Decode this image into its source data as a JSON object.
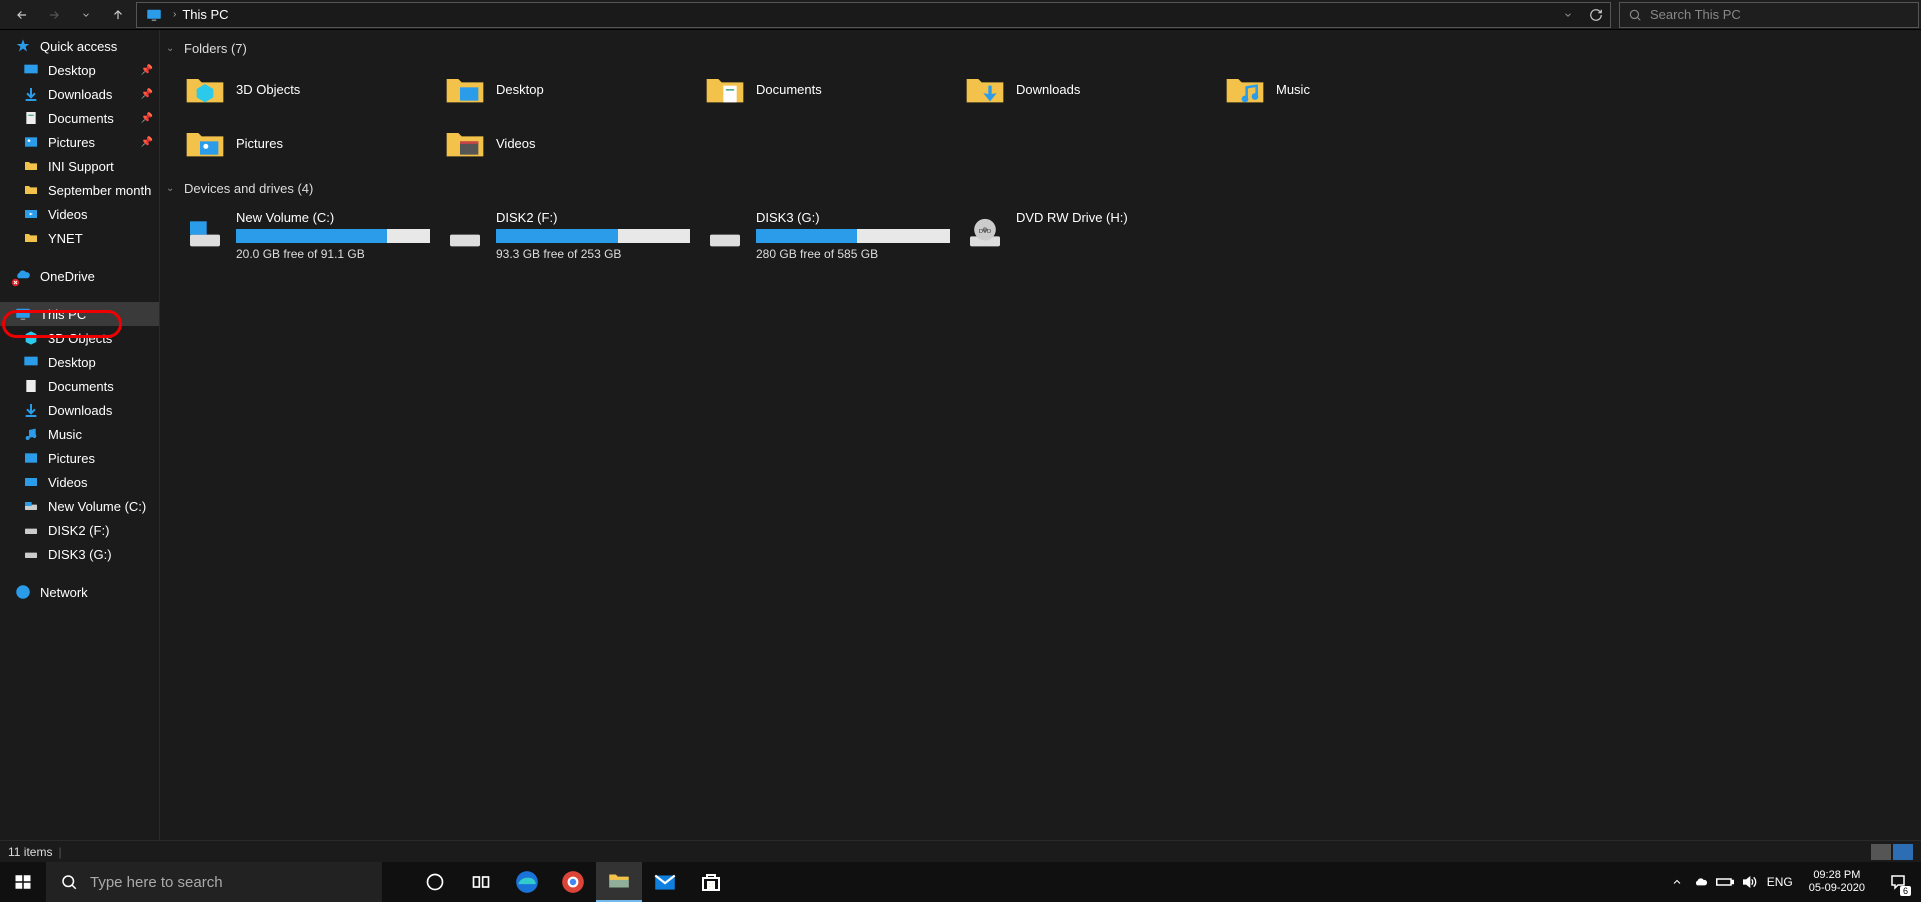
{
  "addressbar": {
    "location": "This PC",
    "refresh_dropdown": "▾",
    "search_placeholder": "Search This PC"
  },
  "sidebar": {
    "quick_access": {
      "label": "Quick access",
      "items": [
        {
          "label": "Desktop",
          "pinned": true
        },
        {
          "label": "Downloads",
          "pinned": true
        },
        {
          "label": "Documents",
          "pinned": true
        },
        {
          "label": "Pictures",
          "pinned": true
        },
        {
          "label": "INI Support",
          "pinned": false
        },
        {
          "label": "September month",
          "pinned": false
        },
        {
          "label": "Videos",
          "pinned": false
        },
        {
          "label": "YNET",
          "pinned": false
        }
      ]
    },
    "onedrive": {
      "label": "OneDrive",
      "status": "error"
    },
    "this_pc": {
      "label": "This PC",
      "items": [
        {
          "label": "3D Objects"
        },
        {
          "label": "Desktop"
        },
        {
          "label": "Documents"
        },
        {
          "label": "Downloads"
        },
        {
          "label": "Music"
        },
        {
          "label": "Pictures"
        },
        {
          "label": "Videos"
        },
        {
          "label": "New Volume (C:)"
        },
        {
          "label": "DISK2 (F:)"
        },
        {
          "label": "DISK3 (G:)"
        }
      ]
    },
    "network": {
      "label": "Network"
    }
  },
  "content": {
    "sections": {
      "folders": {
        "header": "Folders (7)",
        "items": [
          {
            "label": "3D Objects"
          },
          {
            "label": "Desktop"
          },
          {
            "label": "Documents"
          },
          {
            "label": "Downloads"
          },
          {
            "label": "Music"
          },
          {
            "label": "Pictures"
          },
          {
            "label": "Videos"
          }
        ]
      },
      "drives": {
        "header": "Devices and drives (4)",
        "items": [
          {
            "name": "New Volume (C:)",
            "free_text": "20.0 GB free of 91.1 GB",
            "used_pct": 78
          },
          {
            "name": "DISK2 (F:)",
            "free_text": "93.3 GB free of 253 GB",
            "used_pct": 63
          },
          {
            "name": "DISK3 (G:)",
            "free_text": "280 GB free of 585 GB",
            "used_pct": 52
          },
          {
            "name": "DVD RW Drive (H:)",
            "free_text": "",
            "used_pct": null
          }
        ]
      }
    }
  },
  "statusbar": {
    "text": "11 items"
  },
  "taskbar": {
    "search_placeholder": "Type here to search",
    "tray": {
      "lang": "ENG",
      "time": "09:28 PM",
      "date": "05-09-2020",
      "notif_count": "6"
    }
  }
}
